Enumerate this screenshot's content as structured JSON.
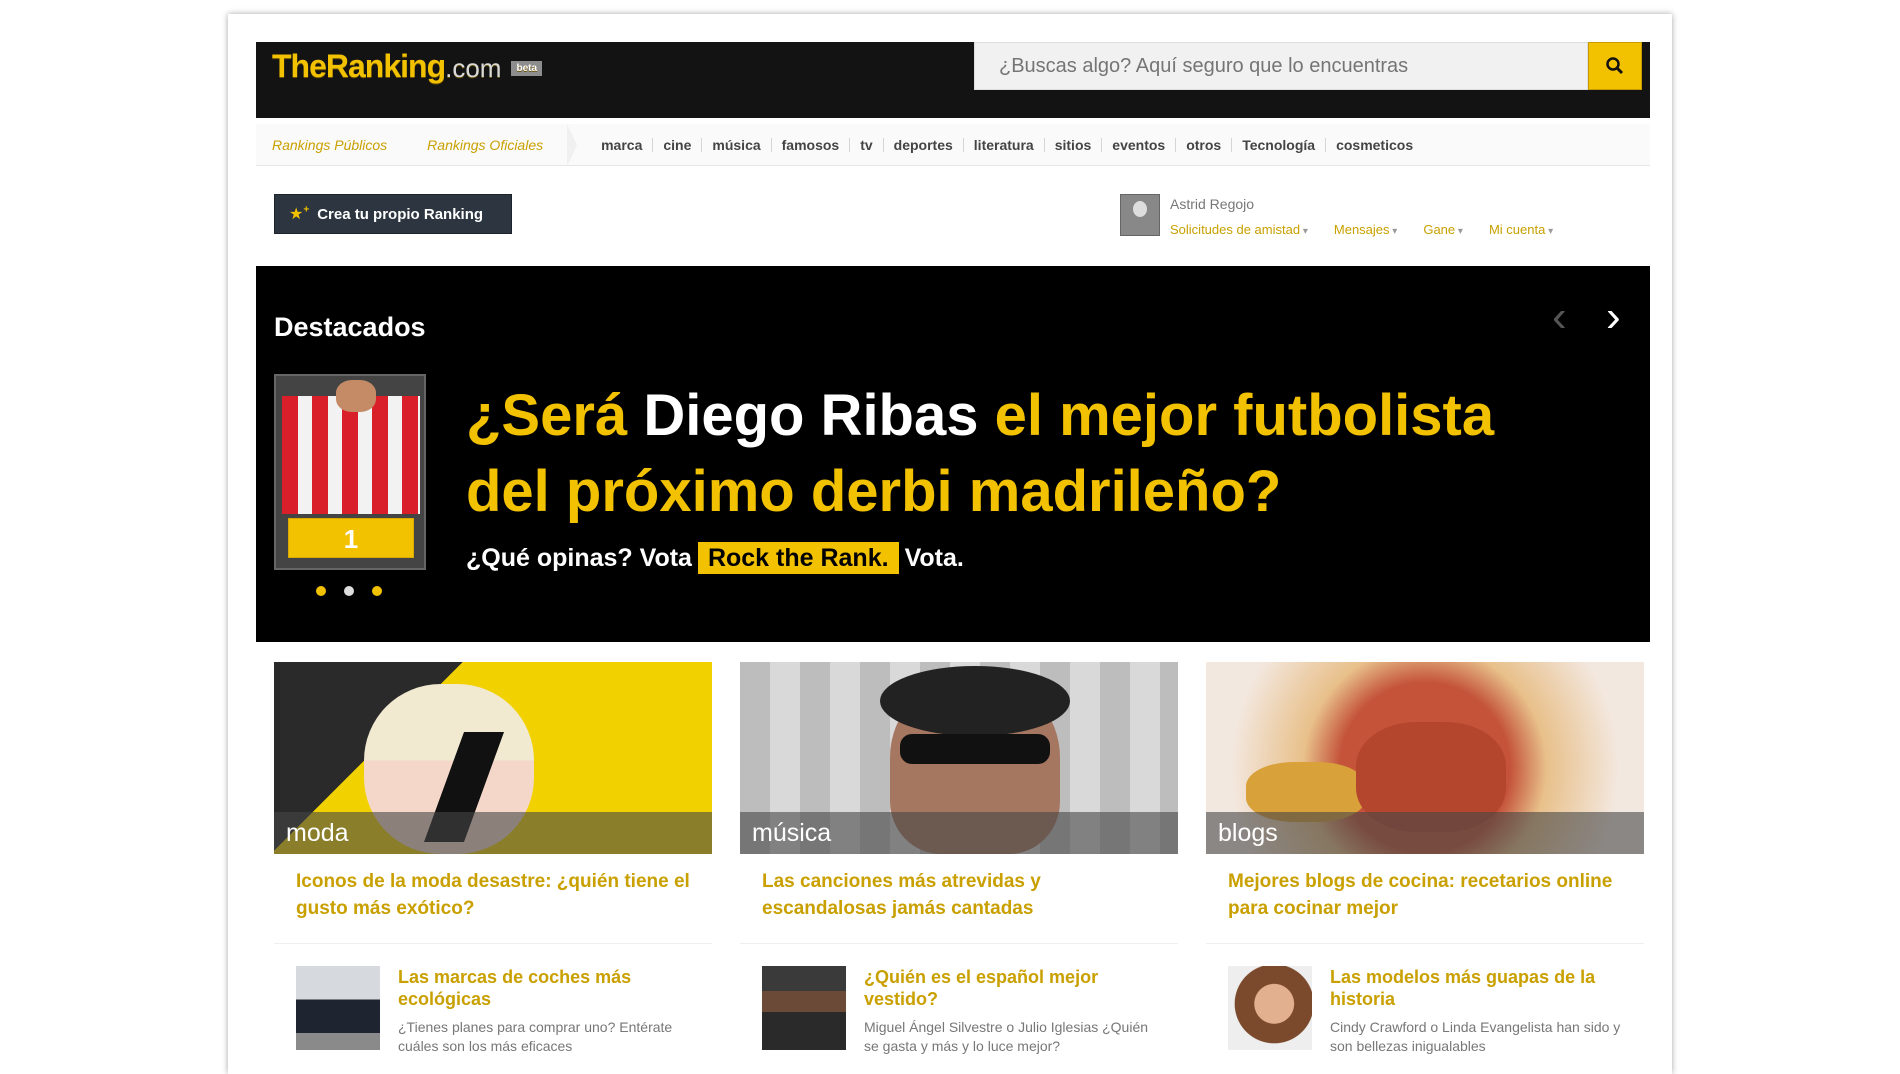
{
  "header": {
    "logo_main": "TheRanking",
    "logo_suffix": ".com",
    "beta_label": "beta",
    "search_placeholder": "¿Buscas algo? Aquí seguro que lo encuentras"
  },
  "nav": {
    "primary": [
      "Rankings Públicos",
      "Rankings Oficiales"
    ],
    "categories": [
      "marca",
      "cine",
      "música",
      "famosos",
      "tv",
      "deportes",
      "literatura",
      "sitios",
      "eventos",
      "otros",
      "Tecnología",
      "cosmeticos"
    ]
  },
  "userbar": {
    "create_button": "Crea tu propio Ranking",
    "username": "Astrid Regojo",
    "menu": [
      "Solicitudes de amistad",
      "Mensajes",
      "Gane",
      "Mi cuenta"
    ]
  },
  "featured": {
    "title": "Destacados",
    "headline_part1": "¿Será ",
    "headline_name": "Diego Ribas",
    "headline_part2": " el mejor futbolista del próximo derbi madrileño?",
    "sub_before": "¿Qué opinas? Vota",
    "sub_highlight": "Rock the Rank.",
    "sub_after": "Vota.",
    "rank_badge": "1"
  },
  "cards": [
    {
      "category": "moda",
      "title": "Iconos de la moda desastre: ¿quién tiene el gusto más exótico?",
      "sub_title": "Las marcas de coches más ecológicas",
      "sub_desc": "¿Tienes planes para comprar uno? Entérate cuáles son los más eficaces"
    },
    {
      "category": "música",
      "title": "Las canciones más atrevidas y escandalosas jamás cantadas",
      "sub_title": "¿Quién es el español mejor vestido?",
      "sub_desc": "Miguel Ángel Silvestre o Julio Iglesias ¿Quién se gasta y más y lo luce mejor?"
    },
    {
      "category": "blogs",
      "title": "Mejores blogs de cocina: recetarios online para cocinar mejor",
      "sub_title": "Las modelos más guapas de la historia",
      "sub_desc": "Cindy Crawford o Linda Evangelista han sido y son bellezas inigualables"
    }
  ],
  "colors": {
    "accent": "#f2c100",
    "header_bg": "#131313",
    "featured_bg": "#000000"
  }
}
